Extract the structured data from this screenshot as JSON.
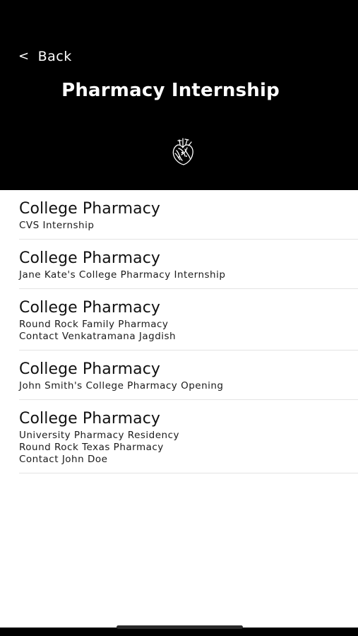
{
  "header": {
    "back_chevron": "<",
    "back_label": "Back",
    "title": "Pharmacy Internship",
    "logo_icon": "anatomical-heart-icon",
    "background_color": "#000000",
    "text_color": "#ffffff"
  },
  "list": {
    "items": [
      {
        "title": "College Pharmacy",
        "lines": [
          "CVS Internship"
        ]
      },
      {
        "title": "College Pharmacy",
        "lines": [
          "Jane Kate's College Pharmacy Internship"
        ]
      },
      {
        "title": "College Pharmacy",
        "lines": [
          "Round Rock Family Pharmacy",
          "Contact Venkatramana Jagdish"
        ]
      },
      {
        "title": "College Pharmacy",
        "lines": [
          "John Smith's College Pharmacy Opening"
        ]
      },
      {
        "title": "College Pharmacy",
        "lines": [
          "University Pharmacy Residency",
          "Round Rock Texas Pharmacy",
          "Contact John Doe"
        ]
      }
    ]
  }
}
